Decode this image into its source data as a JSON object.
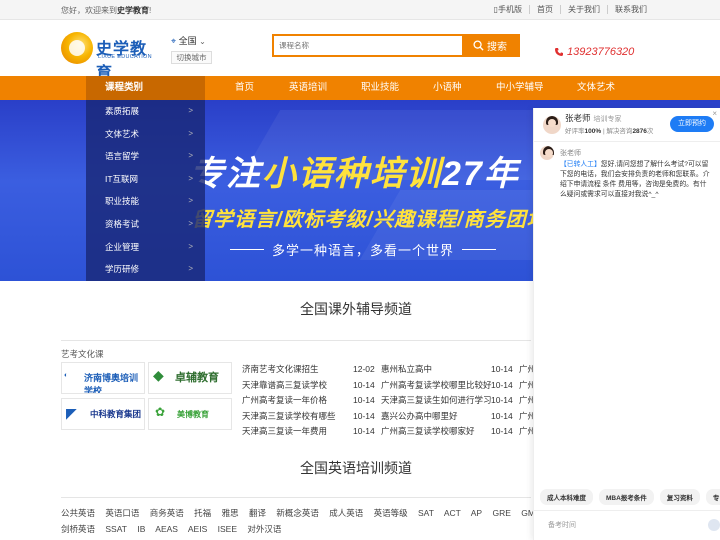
{
  "topbar": {
    "welcome_prefix": "您好，欢迎来到",
    "welcome_site": "史学教育",
    "welcome_suffix": "!",
    "links": [
      "手机版",
      "首页",
      "关于我们",
      "联系我们"
    ]
  },
  "logo": {
    "name": "史学教育",
    "en": "LIXUE EDUCATION"
  },
  "city": {
    "current": "全国",
    "switch_label": "切换城市"
  },
  "search": {
    "placeholder": "课程名称",
    "button": "搜索"
  },
  "phone": "13923776320",
  "nav": {
    "category_label": "课程类别",
    "items": [
      "首页",
      "英语培训",
      "职业技能",
      "小语种",
      "中小学辅导",
      "文体艺术"
    ]
  },
  "category_menu": [
    "素质拓展",
    "文体艺术",
    "语言留学",
    "IT互联网",
    "职业技能",
    "资格考试",
    "企业管理",
    "学历研修"
  ],
  "banner": {
    "headline_a": "专注",
    "headline_b": "小语种培训",
    "headline_c": "27年",
    "sub": "留学语言/欧标考级/兴趣课程/商务团培",
    "slogan": "多学一种语言，多看一个世界"
  },
  "section1": {
    "title": "全国课外辅导频道",
    "category": "艺考文化课",
    "logos": [
      "济南博奥培训学校",
      "卓辅教育",
      "中科教育集团",
      "美博教育"
    ],
    "list": [
      {
        "a": "济南艺考文化课招生",
        "d1": "12-02",
        "b": "惠州私立高中",
        "d2": "10-14",
        "c": "广州"
      },
      {
        "a": "天津靠谱高三复读学校",
        "d1": "10-14",
        "b": "广州高考复读学校哪里比较好",
        "d2": "10-14",
        "c": "广州"
      },
      {
        "a": "广州高考复读一年价格",
        "d1": "10-14",
        "b": "天津高三复读生如何进行学习",
        "d2": "10-14",
        "c": "广州"
      },
      {
        "a": "天津高三复读学校有哪些",
        "d1": "10-14",
        "b": "嘉兴公办高中哪里好",
        "d2": "10-14",
        "c": "广州"
      },
      {
        "a": "天津高三复读一年费用",
        "d1": "10-14",
        "b": "广州高三复读学校哪家好",
        "d2": "10-14",
        "c": "广州"
      }
    ]
  },
  "section2": {
    "title": "全国英语培训频道",
    "tags_row1": [
      "公共英语",
      "英语口语",
      "商务英语",
      "托福",
      "雅思",
      "翻译",
      "新概念英语",
      "成人英语",
      "英语等级",
      "SAT",
      "ACT",
      "AP",
      "GRE",
      "GMAT"
    ],
    "tags_row2": [
      "剑桥英语",
      "SSAT",
      "IB",
      "AEAS",
      "AEIS",
      "ISEE",
      "对外汉语"
    ]
  },
  "chat": {
    "agent_name": "张老师",
    "agent_role": "培训专家",
    "rate_prefix": "好评率",
    "rate_value": "100%",
    "rate_mid": "| 解决咨询",
    "rate_count": "2876",
    "rate_suffix": "次",
    "consult_button": "立即预约",
    "close": "×",
    "msg_agent": "张老师",
    "msg_tag": "【已转人工】",
    "msg_text": "您好,请问您想了解什么考试?可以留下您的电话，我们会安排负责的老师和您联系。介绍下申请流程 条件 费用等，咨询是免费的。有什么疑问或需求可以直接对我说^_^",
    "quick": [
      "成人本科难度",
      "MBA报考条件",
      "复习资料",
      "专"
    ],
    "input_placeholder": "备考时间"
  }
}
